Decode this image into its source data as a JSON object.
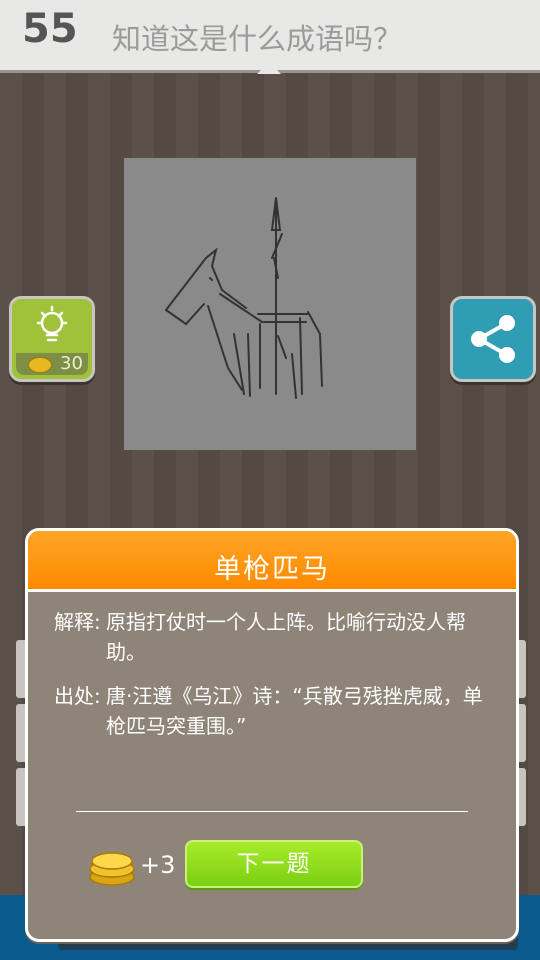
{
  "header": {
    "level": "55",
    "question": "知道这是什么成语吗？"
  },
  "hint": {
    "cost": "30"
  },
  "colors": {
    "accent_orange": "#ff9a1a",
    "next_green": "#8fdc1c",
    "hint_green": "#9fc23a",
    "share_blue": "#2f9db3"
  },
  "icons": {
    "hint": "lightbulb-icon",
    "coin": "coin-icon",
    "share": "share-icon"
  },
  "modal": {
    "title": "单枪匹马",
    "meaning_label": "解释:",
    "meaning_text": "原指打仗时一个人上阵。比喻行动没人帮助。",
    "source_label": "出处:",
    "source_text": "唐·汪遵《乌江》诗：“兵散弓残挫虎威，单枪匹马突重围。”",
    "reward": "+3",
    "next_label": "下一题"
  }
}
